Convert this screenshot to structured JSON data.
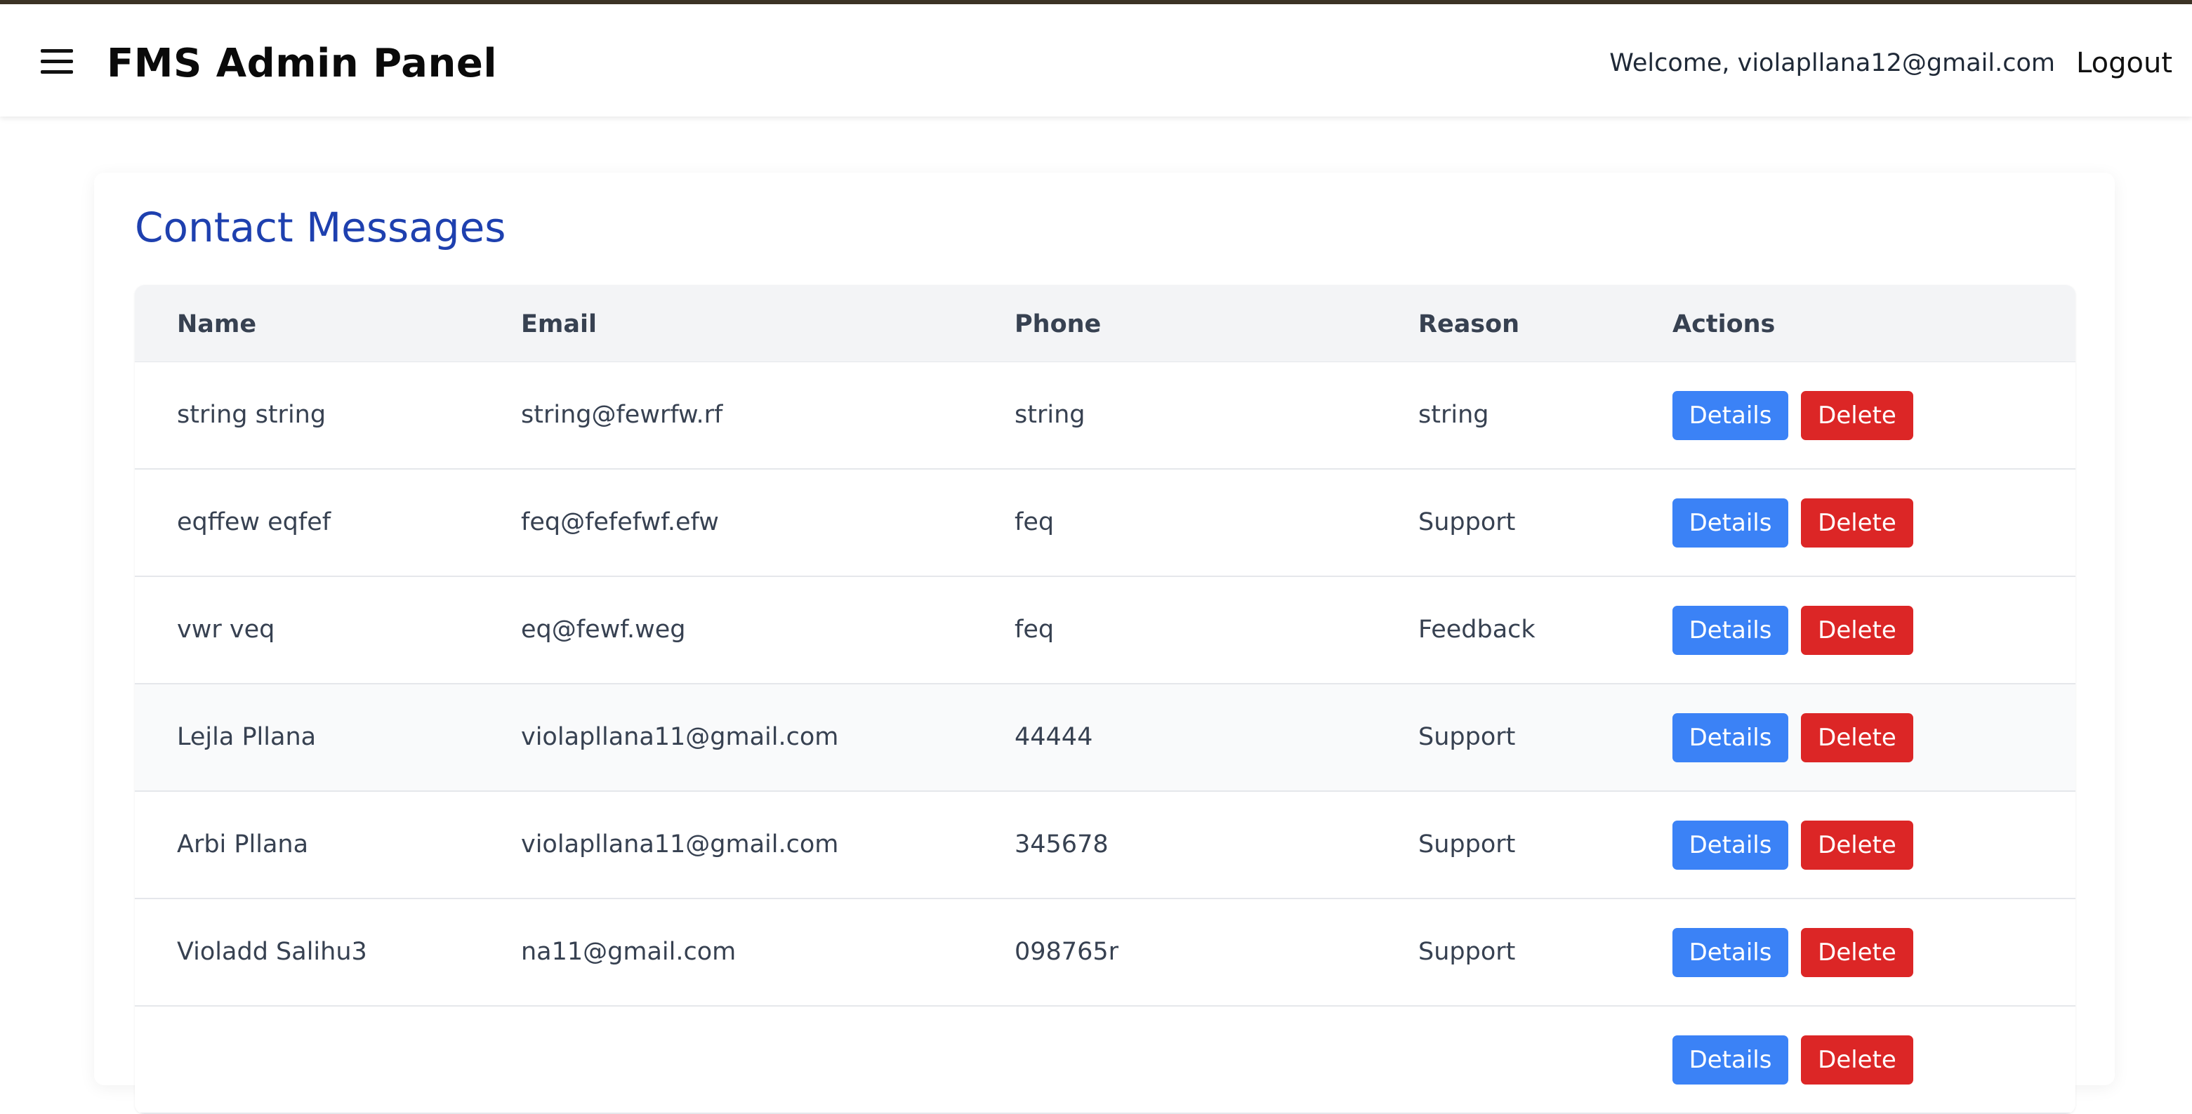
{
  "navbar": {
    "brand": "FMS Admin Panel",
    "menu_icon": "hamburger-menu-icon",
    "welcome": "Welcome, violapllana12@gmail.com",
    "logout_label": "Logout"
  },
  "page": {
    "title": "Contact Messages"
  },
  "table": {
    "headers": {
      "name": "Name",
      "email": "Email",
      "phone": "Phone",
      "reason": "Reason",
      "actions": "Actions"
    },
    "details_label": "Details",
    "delete_label": "Delete",
    "rows": [
      {
        "name": "string string",
        "email": "string@fewrfw.rf",
        "phone": "string",
        "reason": "string"
      },
      {
        "name": "eqffew eqfef",
        "email": "feq@fefefwf.efw",
        "phone": "feq",
        "reason": "Support"
      },
      {
        "name": "vwr veq",
        "email": "eq@fewf.weg",
        "phone": "feq",
        "reason": "Feedback"
      },
      {
        "name": "Lejla Pllana",
        "email": "violapllana11@gmail.com",
        "phone": "44444",
        "reason": "Support"
      },
      {
        "name": "Arbi Pllana",
        "email": "violapllana11@gmail.com",
        "phone": "345678",
        "reason": "Support"
      },
      {
        "name": "Violadd Salihu3",
        "email": "na11@gmail.com",
        "phone": "098765r",
        "reason": "Support"
      }
    ]
  },
  "colors": {
    "title": "#1e40af",
    "details_button": "#3b82f6",
    "delete_button": "#dc2626",
    "header_bg": "#f3f4f6"
  }
}
